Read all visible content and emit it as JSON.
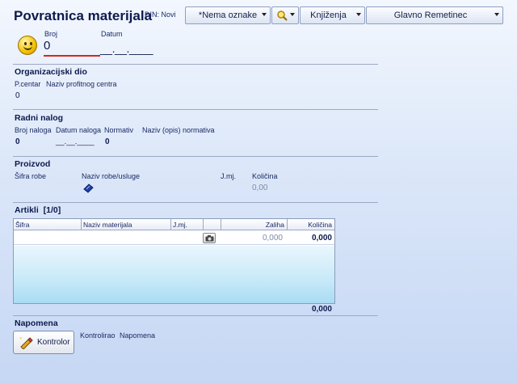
{
  "header": {
    "title": "Povratnica materijala",
    "din": "DIN: Novi",
    "tag_select": "*Nema oznake",
    "knjizenja": "Knjiženja",
    "location": "Glavno Remetinec"
  },
  "doc": {
    "broj_label": "Broj",
    "broj_value": "0",
    "datum_label": "Datum",
    "datum_value": "__.__.____"
  },
  "org": {
    "title": "Organizacijski dio",
    "pcentar_label": "P.centar",
    "naziv_label": "Naziv profitnog centra",
    "pcentar_value": "0"
  },
  "radni": {
    "title": "Radni nalog",
    "broj_label": "Broj naloga",
    "datum_label": "Datum naloga",
    "normativ_label": "Normativ",
    "naziv_label": "Naziv (opis) normativa",
    "broj_value": "0",
    "datum_value": "__.__.____",
    "normativ_value": "0"
  },
  "proizvod": {
    "title": "Proizvod",
    "sifra_label": "Šifra robe",
    "naziv_label": "Naziv robe/usluge",
    "jmj_label": "J.mj.",
    "kolicina_label": "Količina",
    "kolicina_value": "0,00"
  },
  "artikli": {
    "title": "Artikli",
    "count": "[1/0]",
    "columns": [
      "Šifra",
      "Naziv materijala",
      "J.mj.",
      "",
      "Zaliha",
      "Količina"
    ],
    "row": {
      "zaliha": "0,000",
      "kolicina": "0,000"
    },
    "total": "0,000"
  },
  "napomena": {
    "title": "Napomena",
    "kontrolor_label": "Kontrolor",
    "kontrolirao_label": "Kontrolirao",
    "napomena_label": "Napomena"
  }
}
